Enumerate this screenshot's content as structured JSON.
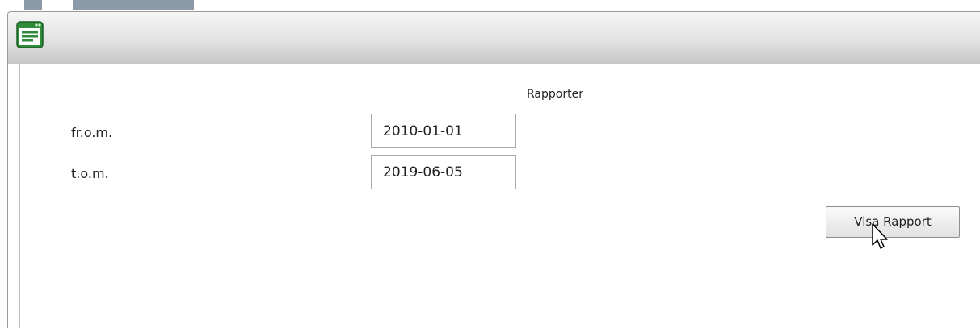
{
  "window": {
    "icon": "document-list-icon"
  },
  "report": {
    "heading": "Rapporter",
    "from_label": "fr.o.m.",
    "from_value": "2010-01-01",
    "to_label": "t.o.m.",
    "to_value": "2019-06-05",
    "show_button_label": "Visa Rapport"
  },
  "colors": {
    "icon_green": "#2e8b3a",
    "titlebar_top": "#f6f6f6",
    "titlebar_bottom": "#c7c7c7"
  }
}
